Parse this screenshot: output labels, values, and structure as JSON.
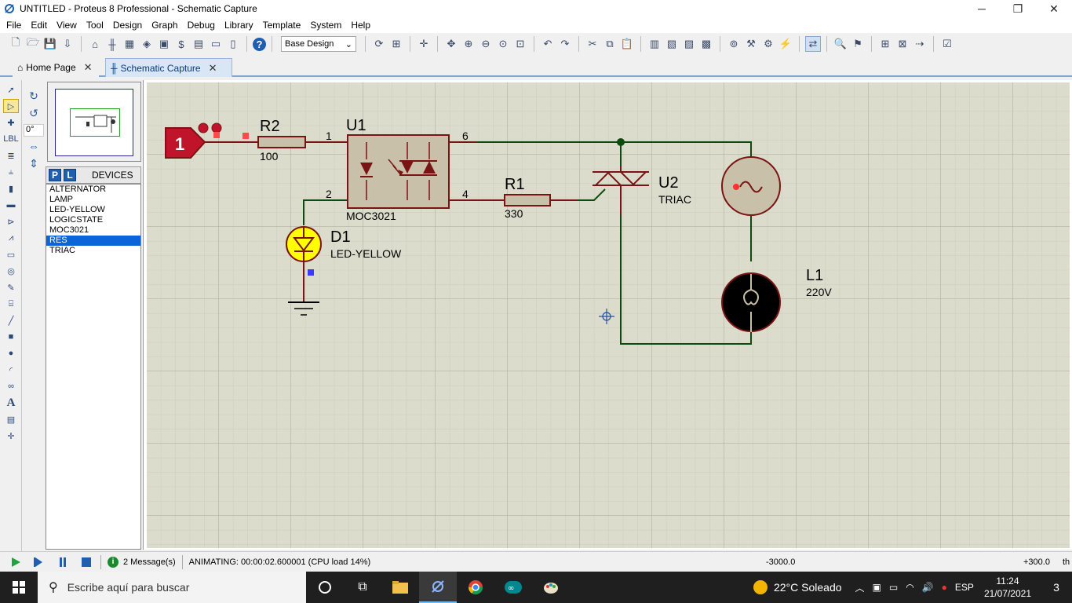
{
  "window": {
    "title": "UNTITLED - Proteus 8 Professional - Schematic Capture",
    "minimize": "─",
    "maximize": "❐",
    "close": "✕"
  },
  "menu": [
    "File",
    "Edit",
    "View",
    "Tool",
    "Design",
    "Graph",
    "Debug",
    "Library",
    "Template",
    "System",
    "Help"
  ],
  "toolbar": {
    "variant_select": "Base Design"
  },
  "tabs": [
    {
      "label": "Home Page",
      "close": "✕"
    },
    {
      "label": "Schematic Capture",
      "close": "✕"
    }
  ],
  "left_panel": {
    "angle": "0°",
    "devices_title": "DEVICES",
    "pick_button": "P",
    "library_button": "L",
    "devices": [
      "ALTERNATOR",
      "LAMP",
      "LED-YELLOW",
      "LOGICSTATE",
      "MOC3021",
      "RES",
      "TRIAC"
    ],
    "selected_device": "RES"
  },
  "schematic": {
    "logicstate_value": "1",
    "r2": {
      "ref": "R2",
      "value": "100"
    },
    "u1": {
      "ref": "U1",
      "value": "MOC3021",
      "pin1": "1",
      "pin2": "2",
      "pin4": "4",
      "pin6": "6"
    },
    "r1": {
      "ref": "R1",
      "value": "330"
    },
    "u2": {
      "ref": "U2",
      "value": "TRIAC"
    },
    "d1": {
      "ref": "D1",
      "value": "LED-YELLOW"
    },
    "l1": {
      "ref": "L1",
      "value": "220V"
    }
  },
  "status": {
    "messages": "2 Message(s)",
    "animation": "ANIMATING: 00:00:02.600001 (CPU load 14%)",
    "coord_x": "-3000.0",
    "coord_y": "+300.0",
    "unit": "th"
  },
  "taskbar": {
    "search_placeholder": "Escribe aquí para buscar",
    "weather": "22°C  Soleado",
    "language": "ESP",
    "time": "11:24",
    "date": "21/07/2021",
    "notifications": "3"
  },
  "colors": {
    "wire": "#7a1414",
    "wire_active": "#0d4a0d",
    "component_fill": "#c8c0a8",
    "grid_bg": "#dcdccc",
    "logicstate_fill": "#c0142a",
    "led_fill": "#ffff00",
    "accent": "#0a66d8"
  }
}
